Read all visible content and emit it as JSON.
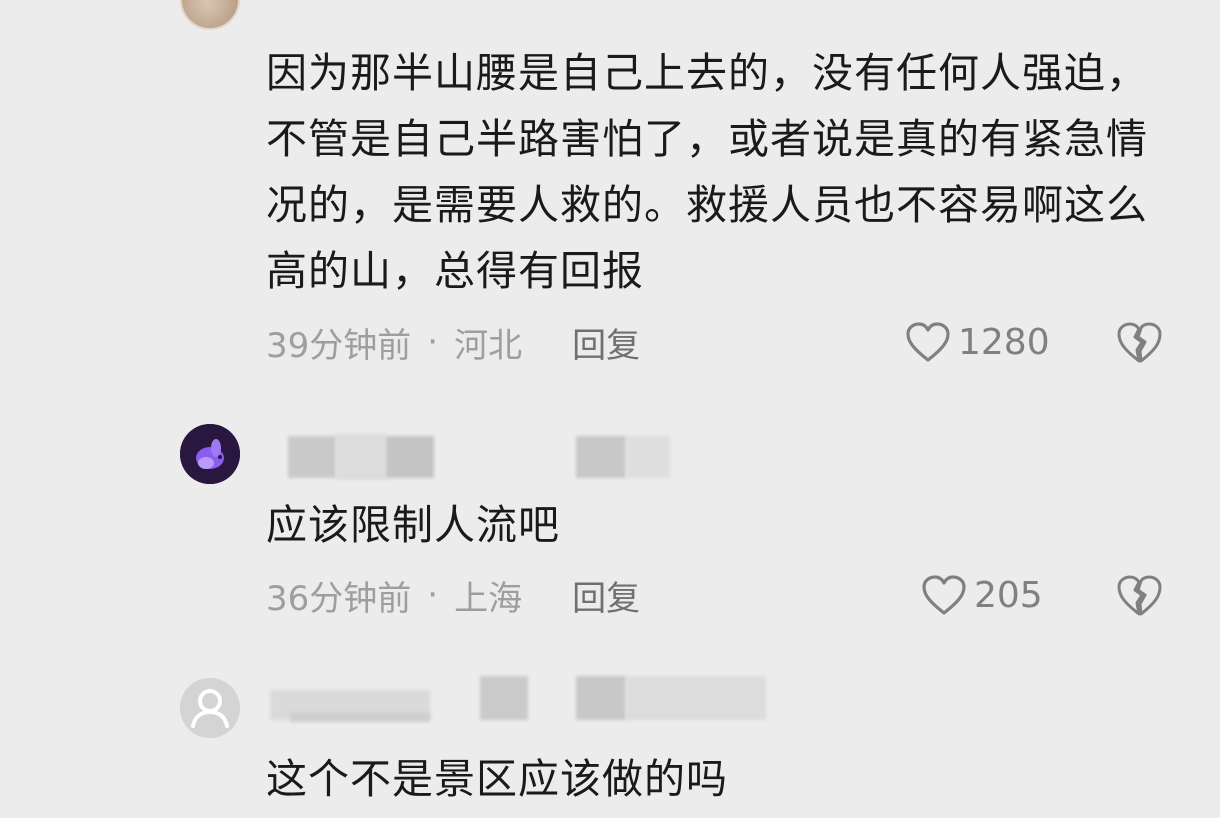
{
  "comments": [
    {
      "text": "因为那半山腰是自己上去的，没有任何人强迫，不管是自己半路害怕了，或者说是真的有紧急情况的，是需要人救的。救援人员也不容易啊这么高的山，总得有回报",
      "time": "39分钟前",
      "separator": "·",
      "location": "河北",
      "reply_label": "回复",
      "likes": "1280"
    },
    {
      "text": "应该限制人流吧",
      "time": "36分钟前",
      "separator": "·",
      "location": "上海",
      "reply_label": "回复",
      "likes": "205"
    },
    {
      "text": "这个不是景区应该做的吗"
    }
  ],
  "icons": {
    "like": "heart-outline-icon",
    "dislike": "broken-heart-icon",
    "default_avatar": "person-silhouette-icon"
  },
  "colors": {
    "background": "#ececec",
    "text": "#1a1a1a",
    "meta": "#9e9e9e",
    "icon": "#808080"
  }
}
